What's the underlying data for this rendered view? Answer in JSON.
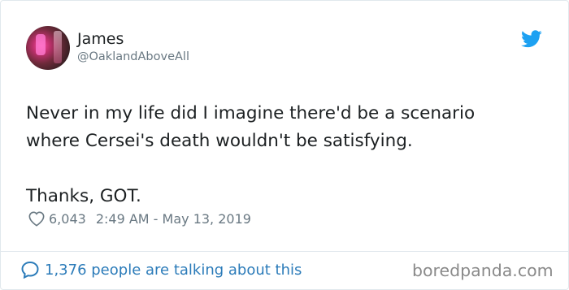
{
  "tweet": {
    "name": "James",
    "handle": "@OaklandAboveAll",
    "text_line1": "Never in my life did I imagine there'd be a scenario",
    "text_line2": "where Cersei's death wouldn't be satisfying.",
    "text_line3": "Thanks, GOT.",
    "likes": "6,043",
    "timestamp": "2:49 AM - May 13, 2019",
    "talking": "1,376 people are talking about this"
  },
  "watermark": "boredpanda.com",
  "icons": {
    "brand": "twitter-bird-icon",
    "like": "heart-icon",
    "comment": "speech-bubble-icon"
  },
  "colors": {
    "twitter_blue": "#1da1f2",
    "link_blue": "#2b7bb9",
    "muted": "#697882",
    "text": "#1c2022"
  }
}
